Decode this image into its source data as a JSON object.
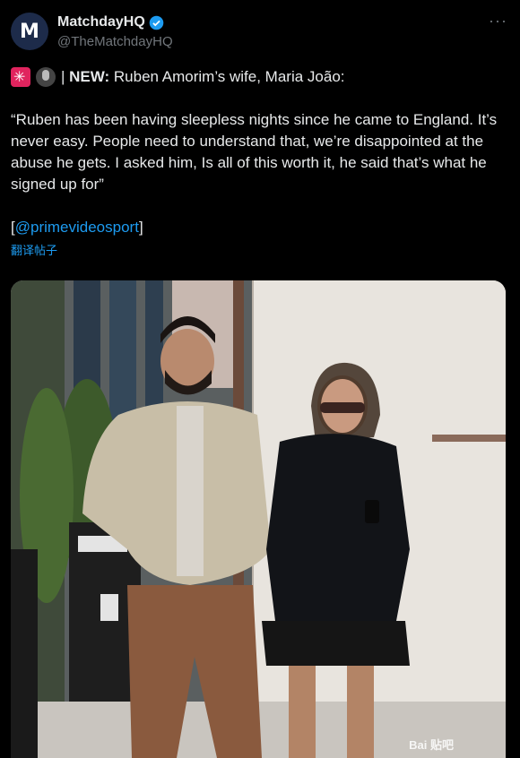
{
  "account": {
    "display_name": "MatchdayHQ",
    "handle": "@TheMatchdayHQ",
    "avatar_letter": "M"
  },
  "tweet": {
    "headline_prefix": "| ",
    "headline_bold": "NEW:",
    "headline_rest": " Ruben Amorim’s wife, Maria João:",
    "quote": "“Ruben has been having sleepless nights since he came to England. It’s never easy. People need to understand that, we’re disappointed at the abuse he gets. I asked him, Is all of this worth it, he said that’s what he signed up for”",
    "link_open": "[",
    "link_text": "@primevideosport",
    "link_close": "]",
    "translate_label": "翻译帖子"
  },
  "photo": {
    "watermark": "Bai 贴吧"
  },
  "icons": {
    "more": "more-options-icon",
    "verified": "verified-badge-icon",
    "siren": "siren-emoji-icon",
    "mic": "microphone-emoji-icon"
  },
  "colors": {
    "link": "#1d9bf0",
    "verified": "#1d9bf0",
    "background": "#000000"
  }
}
